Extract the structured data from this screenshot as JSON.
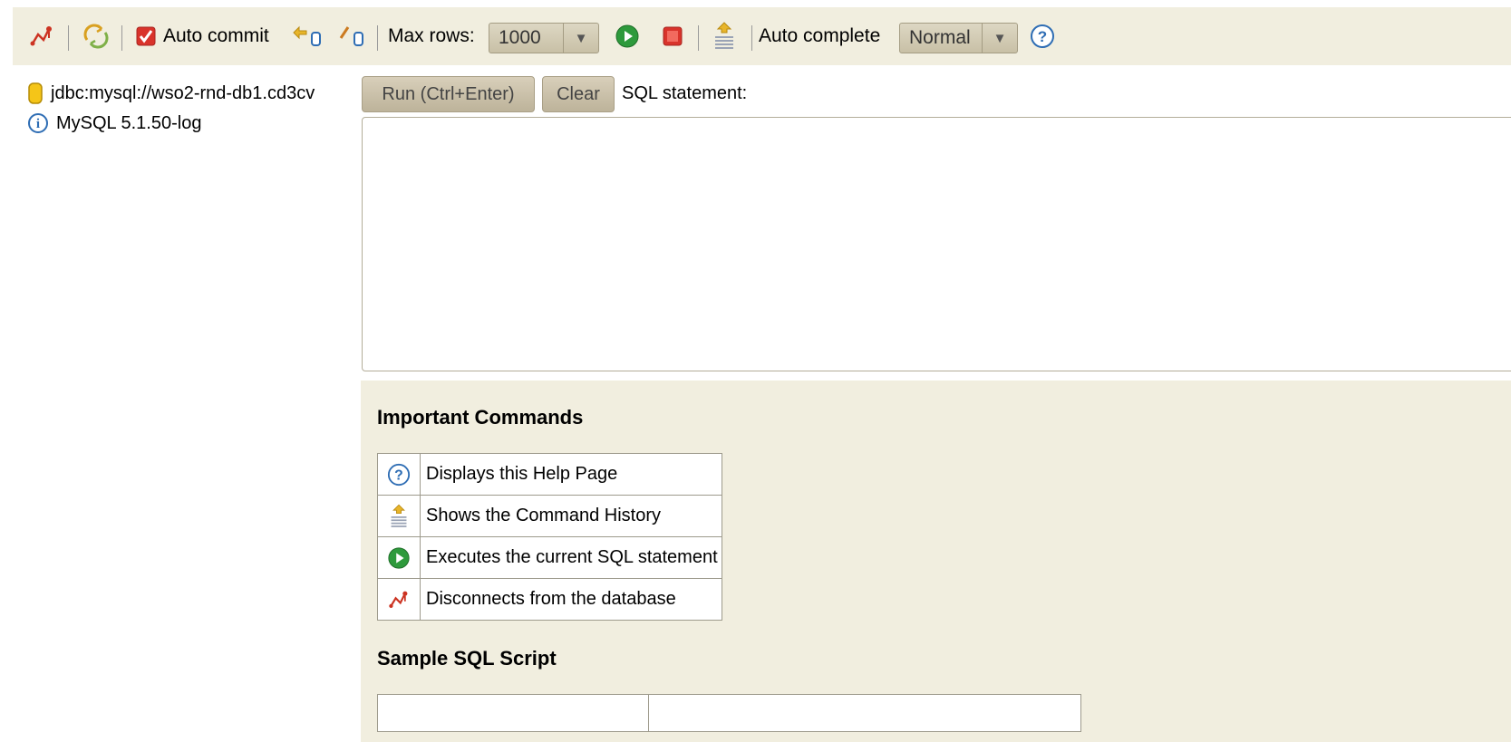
{
  "toolbar": {
    "disconnect_icon": "disconnect-icon",
    "refresh_icon": "refresh-icon",
    "auto_commit_label": "Auto commit",
    "auto_commit_checked": true,
    "commit_icon": "commit-icon",
    "rollback_icon": "rollback-icon",
    "max_rows_label": "Max rows:",
    "max_rows_value": "1000",
    "run_icon": "run-icon",
    "stop_icon": "stop-icon",
    "history_icon": "history-icon",
    "auto_complete_label": "Auto complete",
    "auto_complete_value": "Normal",
    "help_icon": "help-icon"
  },
  "tree": {
    "connection": "jdbc:mysql://wso2-rnd-db1.cd3cv",
    "version": "MySQL 5.1.50-log"
  },
  "editor": {
    "run_label": "Run (Ctrl+Enter)",
    "clear_label": "Clear",
    "sql_label": "SQL statement:",
    "sql_value": ""
  },
  "help": {
    "commands_title": "Important Commands",
    "commands": [
      {
        "icon": "help-icon",
        "text": "Displays this Help Page"
      },
      {
        "icon": "history-icon",
        "text": "Shows the Command History"
      },
      {
        "icon": "run-icon",
        "text": "Executes the current SQL statement"
      },
      {
        "icon": "disconnect-icon",
        "text": "Disconnects from the database"
      }
    ],
    "sample_title": "Sample SQL Script"
  },
  "colors": {
    "panel_bg": "#f1eedf",
    "run_green": "#2e9a3c",
    "stop_red": "#d9332b",
    "help_blue": "#2e6db4",
    "disconnect_red": "#cc3322"
  }
}
